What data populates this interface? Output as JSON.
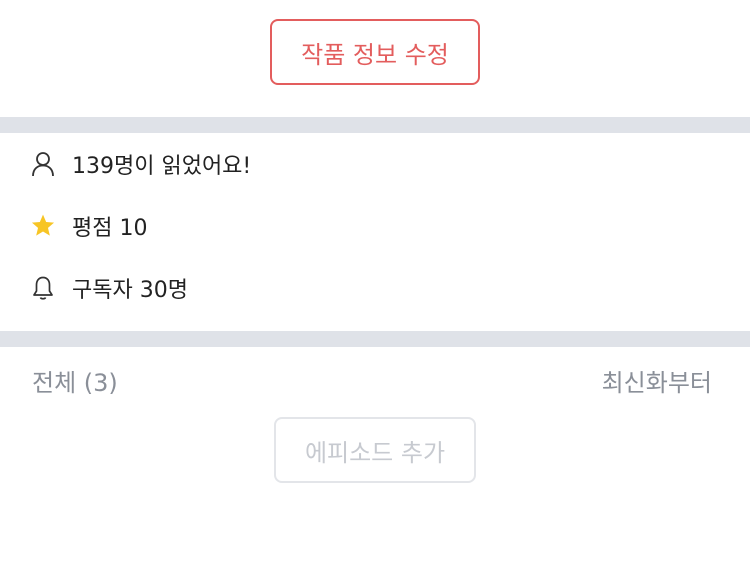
{
  "edit_work_button": {
    "label": "작품 정보 수정"
  },
  "stats": {
    "readers": {
      "text": "139명이 읽었어요!",
      "icon": "person-icon"
    },
    "rating": {
      "text": "평점 10",
      "icon": "star-icon"
    },
    "subscribers": {
      "text": "구독자 30명",
      "icon": "bell-icon"
    }
  },
  "episode_list": {
    "count_label": "전체 (3)",
    "sort_label": "최신화부터",
    "add_button_label": "에피소드 추가"
  },
  "colors": {
    "accent": "#e35d5d",
    "divider": "#dfe2e8",
    "muted_text": "#8a8f98",
    "star": "#f7c525"
  }
}
